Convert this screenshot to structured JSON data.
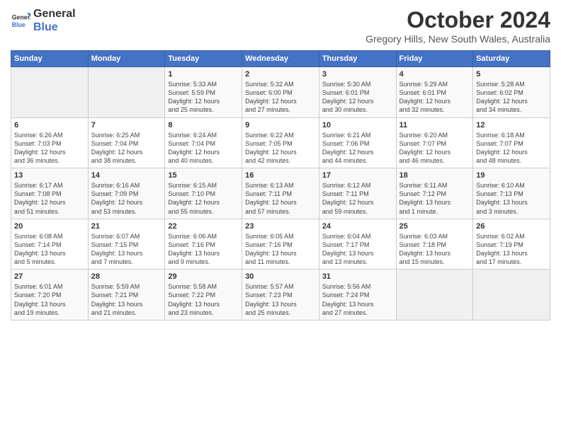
{
  "logo": {
    "line1": "General",
    "line2": "Blue"
  },
  "title": "October 2024",
  "location": "Gregory Hills, New South Wales, Australia",
  "days_of_week": [
    "Sunday",
    "Monday",
    "Tuesday",
    "Wednesday",
    "Thursday",
    "Friday",
    "Saturday"
  ],
  "weeks": [
    [
      {
        "day": "",
        "info": ""
      },
      {
        "day": "",
        "info": ""
      },
      {
        "day": "1",
        "info": "Sunrise: 5:33 AM\nSunset: 5:59 PM\nDaylight: 12 hours\nand 25 minutes."
      },
      {
        "day": "2",
        "info": "Sunrise: 5:32 AM\nSunset: 6:00 PM\nDaylight: 12 hours\nand 27 minutes."
      },
      {
        "day": "3",
        "info": "Sunrise: 5:30 AM\nSunset: 6:01 PM\nDaylight: 12 hours\nand 30 minutes."
      },
      {
        "day": "4",
        "info": "Sunrise: 5:29 AM\nSunset: 6:01 PM\nDaylight: 12 hours\nand 32 minutes."
      },
      {
        "day": "5",
        "info": "Sunrise: 5:28 AM\nSunset: 6:02 PM\nDaylight: 12 hours\nand 34 minutes."
      }
    ],
    [
      {
        "day": "6",
        "info": "Sunrise: 6:26 AM\nSunset: 7:03 PM\nDaylight: 12 hours\nand 36 minutes."
      },
      {
        "day": "7",
        "info": "Sunrise: 6:25 AM\nSunset: 7:04 PM\nDaylight: 12 hours\nand 38 minutes."
      },
      {
        "day": "8",
        "info": "Sunrise: 6:24 AM\nSunset: 7:04 PM\nDaylight: 12 hours\nand 40 minutes."
      },
      {
        "day": "9",
        "info": "Sunrise: 6:22 AM\nSunset: 7:05 PM\nDaylight: 12 hours\nand 42 minutes."
      },
      {
        "day": "10",
        "info": "Sunrise: 6:21 AM\nSunset: 7:06 PM\nDaylight: 12 hours\nand 44 minutes."
      },
      {
        "day": "11",
        "info": "Sunrise: 6:20 AM\nSunset: 7:07 PM\nDaylight: 12 hours\nand 46 minutes."
      },
      {
        "day": "12",
        "info": "Sunrise: 6:18 AM\nSunset: 7:07 PM\nDaylight: 12 hours\nand 48 minutes."
      }
    ],
    [
      {
        "day": "13",
        "info": "Sunrise: 6:17 AM\nSunset: 7:08 PM\nDaylight: 12 hours\nand 51 minutes."
      },
      {
        "day": "14",
        "info": "Sunrise: 6:16 AM\nSunset: 7:09 PM\nDaylight: 12 hours\nand 53 minutes."
      },
      {
        "day": "15",
        "info": "Sunrise: 6:15 AM\nSunset: 7:10 PM\nDaylight: 12 hours\nand 55 minutes."
      },
      {
        "day": "16",
        "info": "Sunrise: 6:13 AM\nSunset: 7:11 PM\nDaylight: 12 hours\nand 57 minutes."
      },
      {
        "day": "17",
        "info": "Sunrise: 6:12 AM\nSunset: 7:11 PM\nDaylight: 12 hours\nand 59 minutes."
      },
      {
        "day": "18",
        "info": "Sunrise: 6:11 AM\nSunset: 7:12 PM\nDaylight: 13 hours\nand 1 minute."
      },
      {
        "day": "19",
        "info": "Sunrise: 6:10 AM\nSunset: 7:13 PM\nDaylight: 13 hours\nand 3 minutes."
      }
    ],
    [
      {
        "day": "20",
        "info": "Sunrise: 6:08 AM\nSunset: 7:14 PM\nDaylight: 13 hours\nand 5 minutes."
      },
      {
        "day": "21",
        "info": "Sunrise: 6:07 AM\nSunset: 7:15 PM\nDaylight: 13 hours\nand 7 minutes."
      },
      {
        "day": "22",
        "info": "Sunrise: 6:06 AM\nSunset: 7:16 PM\nDaylight: 13 hours\nand 9 minutes."
      },
      {
        "day": "23",
        "info": "Sunrise: 6:05 AM\nSunset: 7:16 PM\nDaylight: 13 hours\nand 11 minutes."
      },
      {
        "day": "24",
        "info": "Sunrise: 6:04 AM\nSunset: 7:17 PM\nDaylight: 13 hours\nand 13 minutes."
      },
      {
        "day": "25",
        "info": "Sunrise: 6:03 AM\nSunset: 7:18 PM\nDaylight: 13 hours\nand 15 minutes."
      },
      {
        "day": "26",
        "info": "Sunrise: 6:02 AM\nSunset: 7:19 PM\nDaylight: 13 hours\nand 17 minutes."
      }
    ],
    [
      {
        "day": "27",
        "info": "Sunrise: 6:01 AM\nSunset: 7:20 PM\nDaylight: 13 hours\nand 19 minutes."
      },
      {
        "day": "28",
        "info": "Sunrise: 5:59 AM\nSunset: 7:21 PM\nDaylight: 13 hours\nand 21 minutes."
      },
      {
        "day": "29",
        "info": "Sunrise: 5:58 AM\nSunset: 7:22 PM\nDaylight: 13 hours\nand 23 minutes."
      },
      {
        "day": "30",
        "info": "Sunrise: 5:57 AM\nSunset: 7:23 PM\nDaylight: 13 hours\nand 25 minutes."
      },
      {
        "day": "31",
        "info": "Sunrise: 5:56 AM\nSunset: 7:24 PM\nDaylight: 13 hours\nand 27 minutes."
      },
      {
        "day": "",
        "info": ""
      },
      {
        "day": "",
        "info": ""
      }
    ]
  ]
}
